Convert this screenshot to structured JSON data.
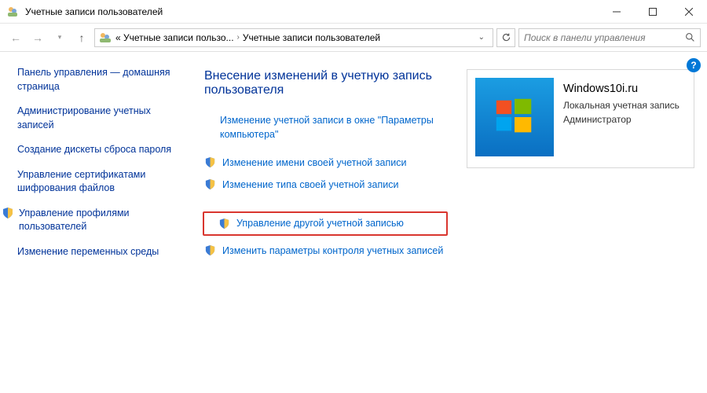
{
  "titlebar": {
    "title": "Учетные записи пользователей"
  },
  "nav": {
    "bc1": "« Учетные записи пользо...",
    "bc2": "Учетные записи пользователей",
    "search_placeholder": "Поиск в панели управления"
  },
  "sidebar": {
    "home": "Панель управления — домашняя страница",
    "admin": "Администрирование учетных записей",
    "reset_disk": "Создание дискеты сброса пароля",
    "certs": "Управление сертификатами шифрования файлов",
    "profiles": "Управление профилями пользователей",
    "env": "Изменение переменных среды"
  },
  "main": {
    "title": "Внесение изменений в учетную запись пользователя",
    "opt_pc_settings": "Изменение учетной записи в окне \"Параметры компьютера\"",
    "opt_change_name": "Изменение имени своей учетной записи",
    "opt_change_type": "Изменение типа своей учетной записи",
    "opt_manage_other": "Управление другой учетной записью",
    "opt_uac": "Изменить параметры контроля учетных записей"
  },
  "user": {
    "name": "Windows10i.ru",
    "type": "Локальная учетная запись",
    "role": "Администратор"
  }
}
